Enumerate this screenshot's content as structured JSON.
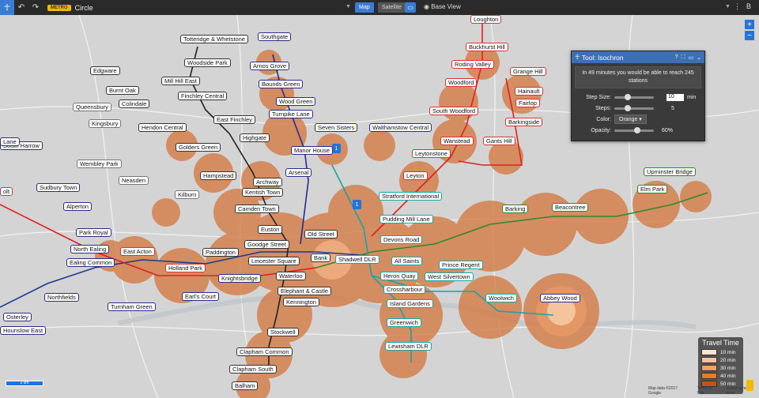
{
  "toolbar": {
    "home_icon": "person-icon",
    "undo_icon": "↶",
    "redo_icon": "↷",
    "badge": "METRO",
    "line_name": "Circle",
    "map_label": "Map",
    "satellite_label": "Satellite",
    "base_view": "Base View",
    "right_icon_1": "⋮",
    "right_icon_2": "B"
  },
  "tool": {
    "title": "Tool: Isochron",
    "message": "In 49 minutes you would be able to reach 245 stations",
    "step_size_label": "Step Size:",
    "step_size_value": "10",
    "step_size_unit": "min",
    "steps_label": "Steps:",
    "steps_value": "5",
    "color_label": "Color:",
    "color_value": "Orange",
    "opacity_label": "Opacity:",
    "opacity_value": "60%",
    "step_size_fraction": 0.3,
    "steps_fraction": 0.3,
    "opacity_fraction": 0.6
  },
  "legend": {
    "title": "Travel Time",
    "items": [
      {
        "label": "10 min",
        "color": "#fbe3cc"
      },
      {
        "label": "20 min",
        "color": "#f9c49b"
      },
      {
        "label": "30 min",
        "color": "#f4a062"
      },
      {
        "label": "40 min",
        "color": "#e97a2d"
      },
      {
        "label": "50 min",
        "color": "#c5521a"
      }
    ]
  },
  "zoom": {
    "in": "+",
    "out": "−"
  },
  "scale_label": "2 km",
  "attribution": [
    "Map data ©2017 Google",
    "Terms of Use",
    "Report a map error"
  ],
  "markers": [
    "1",
    "1"
  ],
  "stations": [
    {
      "name": "Loughton",
      "color": "red"
    },
    {
      "name": "Buckhurst Hill",
      "color": "red"
    },
    {
      "name": "Roding Valley",
      "color": "red"
    },
    {
      "name": "Grange Hill",
      "color": "red"
    },
    {
      "name": "Woodford",
      "color": "red"
    },
    {
      "name": "Hainault",
      "color": "red"
    },
    {
      "name": "Fairlop",
      "color": "red"
    },
    {
      "name": "South Woodford",
      "color": "red"
    },
    {
      "name": "Barkingside",
      "color": "red"
    },
    {
      "name": "Wanstead",
      "color": "red"
    },
    {
      "name": "Gants Hill",
      "color": "red"
    },
    {
      "name": "Leytonstone",
      "color": "red"
    },
    {
      "name": "Leyton",
      "color": "red"
    },
    {
      "name": "Totteridge & Whetstone",
      "color": "dark"
    },
    {
      "name": "Southgate",
      "color": "blue"
    },
    {
      "name": "Woodside Park",
      "color": "dark"
    },
    {
      "name": "Arnos Grove",
      "color": "blue"
    },
    {
      "name": "Edgware",
      "color": "dark"
    },
    {
      "name": "Mill Hill East",
      "color": "dark"
    },
    {
      "name": "Bounds Green",
      "color": "blue"
    },
    {
      "name": "Burnt Oak",
      "color": "dark"
    },
    {
      "name": "Colindale",
      "color": "dark"
    },
    {
      "name": "Finchley Central",
      "color": "dark"
    },
    {
      "name": "Wood Green",
      "color": "blue"
    },
    {
      "name": "Queensbury",
      "color": "grey"
    },
    {
      "name": "Turnpike Lane",
      "color": "blue"
    },
    {
      "name": "Kingsbury",
      "color": "grey"
    },
    {
      "name": "East Finchley",
      "color": "dark"
    },
    {
      "name": "Hendon Central",
      "color": "dark"
    },
    {
      "name": "Seven Sisters",
      "color": "blue"
    },
    {
      "name": "Walthamstow Central",
      "color": "blue"
    },
    {
      "name": "Highgate",
      "color": "dark"
    },
    {
      "name": "Golders Green",
      "color": "dark"
    },
    {
      "name": "Manor House",
      "color": "blue"
    },
    {
      "name": "Wembley Park",
      "color": "grey"
    },
    {
      "name": "Archway",
      "color": "dark"
    },
    {
      "name": "Arsenal",
      "color": "blue"
    },
    {
      "name": "Hampstead",
      "color": "dark"
    },
    {
      "name": "Neasden",
      "color": "grey"
    },
    {
      "name": "Sudbury Town",
      "color": "blue"
    },
    {
      "name": "Kentish Town",
      "color": "dark"
    },
    {
      "name": "Kilburn",
      "color": "grey"
    },
    {
      "name": "Stratford International",
      "color": "teal"
    },
    {
      "name": "Upminster Bridge",
      "color": "green"
    },
    {
      "name": "Elm Park",
      "color": "green"
    },
    {
      "name": "Alperton",
      "color": "blue"
    },
    {
      "name": "Camden Town",
      "color": "dark"
    },
    {
      "name": "Barking",
      "color": "green"
    },
    {
      "name": "Beacontree",
      "color": "green"
    },
    {
      "name": "Pudding Mill Lane",
      "color": "teal"
    },
    {
      "name": "Park Royal",
      "color": "blue"
    },
    {
      "name": "Euston",
      "color": "dark"
    },
    {
      "name": "Old Street",
      "color": "dark"
    },
    {
      "name": "Devons Road",
      "color": "teal"
    },
    {
      "name": "North Ealing",
      "color": "blue"
    },
    {
      "name": "Goodge Street",
      "color": "dark"
    },
    {
      "name": "East Acton",
      "color": "red"
    },
    {
      "name": "Paddington",
      "color": "dark"
    },
    {
      "name": "Ealing Common",
      "color": "blue"
    },
    {
      "name": "Leicester Square",
      "color": "dark"
    },
    {
      "name": "Bank",
      "color": "dark"
    },
    {
      "name": "Shadwell DLR",
      "color": "teal"
    },
    {
      "name": "All Saints",
      "color": "teal"
    },
    {
      "name": "Prince Regent",
      "color": "teal"
    },
    {
      "name": "Holland Park",
      "color": "red"
    },
    {
      "name": "Waterloo",
      "color": "dark"
    },
    {
      "name": "Knightsbridge",
      "color": "blue"
    },
    {
      "name": "Heron Quay",
      "color": "teal"
    },
    {
      "name": "West Silvertown",
      "color": "teal"
    },
    {
      "name": "Northfields",
      "color": "blue"
    },
    {
      "name": "Elephant & Castle",
      "color": "dark"
    },
    {
      "name": "Crossharbour",
      "color": "teal"
    },
    {
      "name": "Turnham Green",
      "color": "blue"
    },
    {
      "name": "Earl's Court",
      "color": "blue"
    },
    {
      "name": "Woolwich",
      "color": "teal"
    },
    {
      "name": "Abbey Wood",
      "color": "blue"
    },
    {
      "name": "Kennington",
      "color": "dark"
    },
    {
      "name": "Island Gardens",
      "color": "teal"
    },
    {
      "name": "Osterley",
      "color": "blue"
    },
    {
      "name": "Greenwich",
      "color": "teal"
    },
    {
      "name": "Hounslow East",
      "color": "blue"
    },
    {
      "name": "Stockwell",
      "color": "dark"
    },
    {
      "name": "Clapham Common",
      "color": "dark"
    },
    {
      "name": "Lewisham DLR",
      "color": "teal"
    },
    {
      "name": "Clapham South",
      "color": "dark"
    },
    {
      "name": "Balham",
      "color": "dark"
    },
    {
      "name": "South Harrow",
      "color": "blue"
    },
    {
      "name": "Lane",
      "color": "blue"
    },
    {
      "name": "olt",
      "color": "red"
    }
  ]
}
